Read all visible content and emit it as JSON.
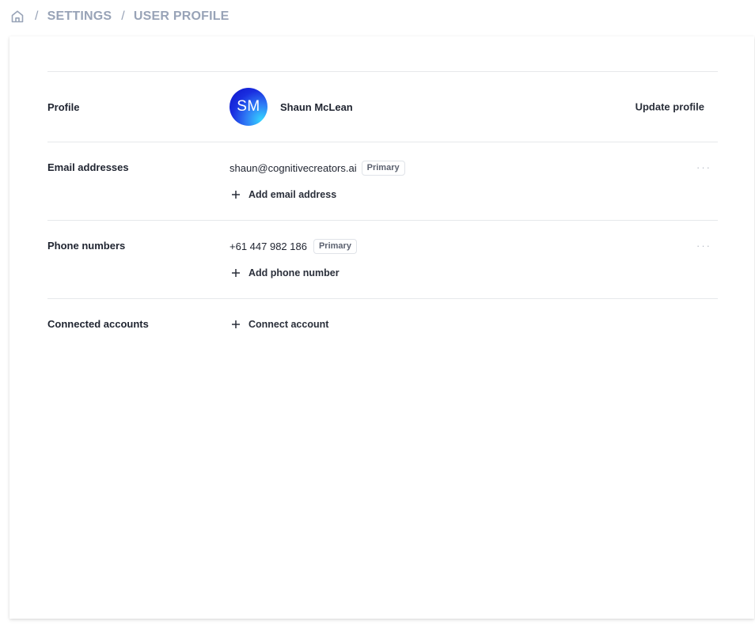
{
  "breadcrumb": {
    "home_icon": "home-icon",
    "items": [
      "SETTINGS",
      "USER PROFILE"
    ],
    "separator": "/"
  },
  "profile": {
    "label": "Profile",
    "avatar_initials": "SM",
    "name": "Shaun McLean",
    "update_label": "Update profile"
  },
  "email": {
    "label": "Email addresses",
    "address": "shaun@cognitivecreators.ai",
    "badge": "Primary",
    "more_label": "···",
    "add_label": "Add email address"
  },
  "phone": {
    "label": "Phone numbers",
    "number": "+61 447 982 186",
    "badge": "Primary",
    "more_label": "···",
    "add_label": "Add phone number"
  },
  "connected": {
    "label": "Connected accounts",
    "add_label": "Connect account"
  },
  "colors": {
    "breadcrumb": "#98a3b7",
    "divider": "#e6e8eb",
    "avatar_gradient": [
      "#0d12c9",
      "#34d6ff"
    ]
  }
}
